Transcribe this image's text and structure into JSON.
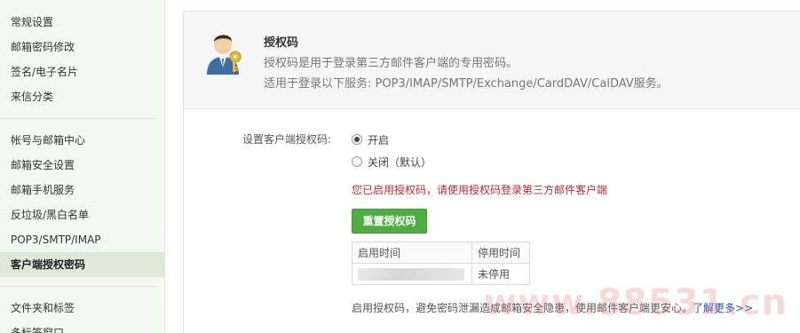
{
  "sidebar": {
    "items": [
      {
        "label": "常规设置",
        "name": "sidebar-item-general"
      },
      {
        "label": "邮箱密码修改",
        "name": "sidebar-item-password"
      },
      {
        "label": "签名/电子名片",
        "name": "sidebar-item-signature"
      },
      {
        "label": "来信分类",
        "name": "sidebar-item-filters"
      },
      {
        "label": "帐号与邮箱中心",
        "name": "sidebar-item-account-center"
      },
      {
        "label": "邮箱安全设置",
        "name": "sidebar-item-security"
      },
      {
        "label": "邮箱手机服务",
        "name": "sidebar-item-mobile"
      },
      {
        "label": "反垃圾/黑白名单",
        "name": "sidebar-item-antispam"
      },
      {
        "label": "POP3/SMTP/IMAP",
        "name": "sidebar-item-pop3"
      },
      {
        "label": "客户端授权密码",
        "name": "sidebar-item-client-auth"
      },
      {
        "label": "文件夹和标签",
        "name": "sidebar-item-folders"
      },
      {
        "label": "多标签窗口",
        "name": "sidebar-item-tabs"
      }
    ]
  },
  "intro": {
    "title": "授权码",
    "description": "授权码是用于登录第三方邮件客户端的专用密码。",
    "services": "适用于登录以下服务: POP3/IMAP/SMTP/Exchange/CardDAV/CalDAV服务。"
  },
  "form": {
    "field_label": "设置客户端授权码:",
    "option_on": "开启",
    "option_off": "关闭（默认）",
    "selected": "开启",
    "notice": "您已启用授权码，请使用授权码登录第三方邮件客户端",
    "reset_button": "重置授权码"
  },
  "table": {
    "headers": [
      "启用时间",
      "停用时间"
    ],
    "rows": [
      {
        "enabled_time": "",
        "disabled_time": "未停用"
      }
    ]
  },
  "footer": {
    "note": "启用授权码，避免密码泄漏造成邮箱安全隐患，使用邮件客户端更安心。",
    "link": "了解更多>>"
  },
  "watermark": "www.88531.cn",
  "colors": {
    "accent_green": "#4eae43",
    "notice_red": "#c0282d",
    "link_blue": "#2255bb",
    "sidebar_bg": "#f4f8f3",
    "sidebar_active": "#dde9d9"
  }
}
